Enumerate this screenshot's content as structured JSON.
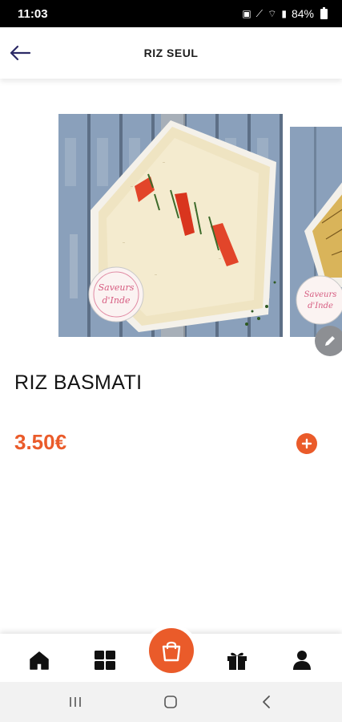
{
  "status_bar": {
    "time": "11:03",
    "battery": "84%"
  },
  "header": {
    "title": "RIZ SEUL",
    "back_icon": "arrow-left-icon"
  },
  "carousel": {
    "images": [
      {
        "subject": "basmati rice platter",
        "logo_text": "Saveurs d'Inde"
      },
      {
        "subject": "rice dish (partial)",
        "logo_text": "Saveurs d'Inde"
      }
    ]
  },
  "product": {
    "name": "RIZ BASMATI",
    "price": "3.50€"
  },
  "bottom_nav": {
    "items": [
      {
        "icon": "home-icon"
      },
      {
        "icon": "grid-icon"
      },
      {
        "icon": "shopping-bag-icon"
      },
      {
        "icon": "gift-icon"
      },
      {
        "icon": "user-icon"
      }
    ]
  },
  "colors": {
    "accent": "#ea5b2a",
    "nav_icon": "#111111",
    "back_arrow": "#2c2a66"
  }
}
